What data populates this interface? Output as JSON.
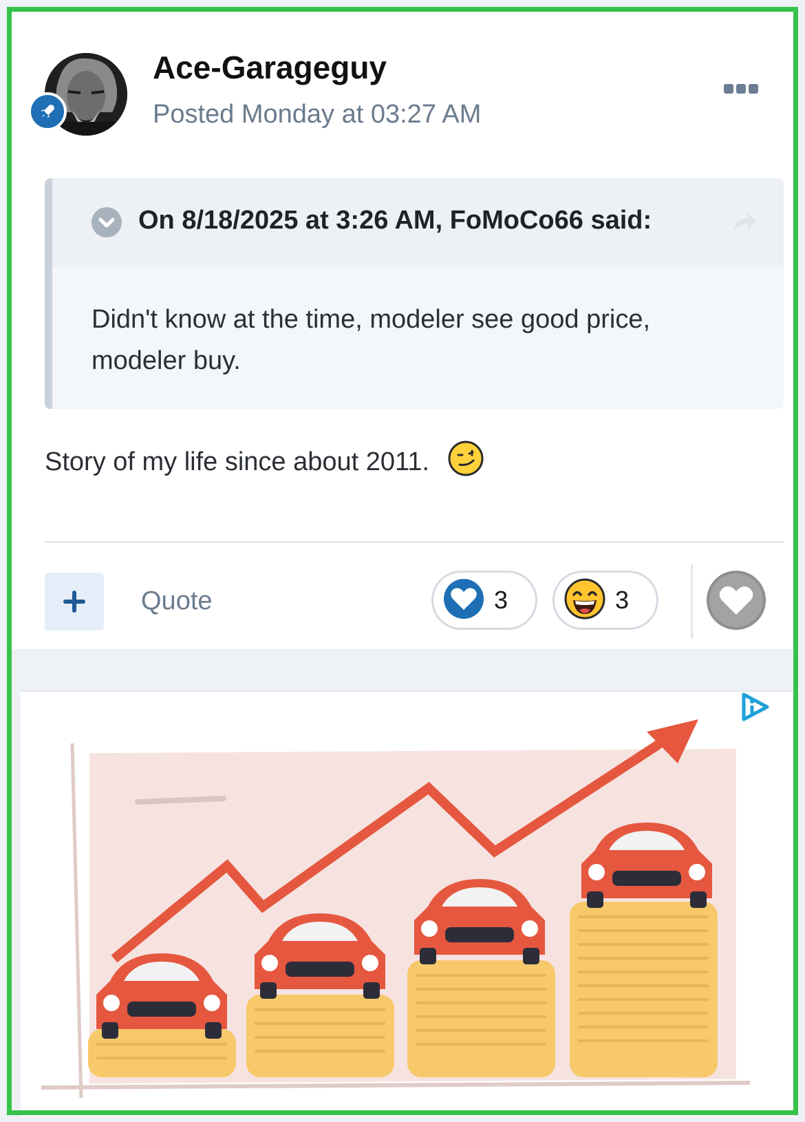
{
  "post": {
    "author": "Ace-Garageguy",
    "posted": "Posted Monday at 03:27 AM",
    "quote": {
      "citation": "On 8/18/2025 at 3:26 AM, FoMoCo66 said:",
      "body": "Didn't know at the time, modeler see good price, modeler buy."
    },
    "content": "Story of my life since about 2011."
  },
  "actions": {
    "quote_label": "Quote",
    "reactions": [
      {
        "icon": "heart-reaction-icon",
        "count": "3"
      },
      {
        "icon": "laugh-reaction-icon",
        "count": "3"
      }
    ]
  },
  "colors": {
    "accent": "#1e6fb5",
    "frame": "#35c24a",
    "ad_arrow": "#e5573f",
    "ad_coins": "#f7c96a"
  }
}
